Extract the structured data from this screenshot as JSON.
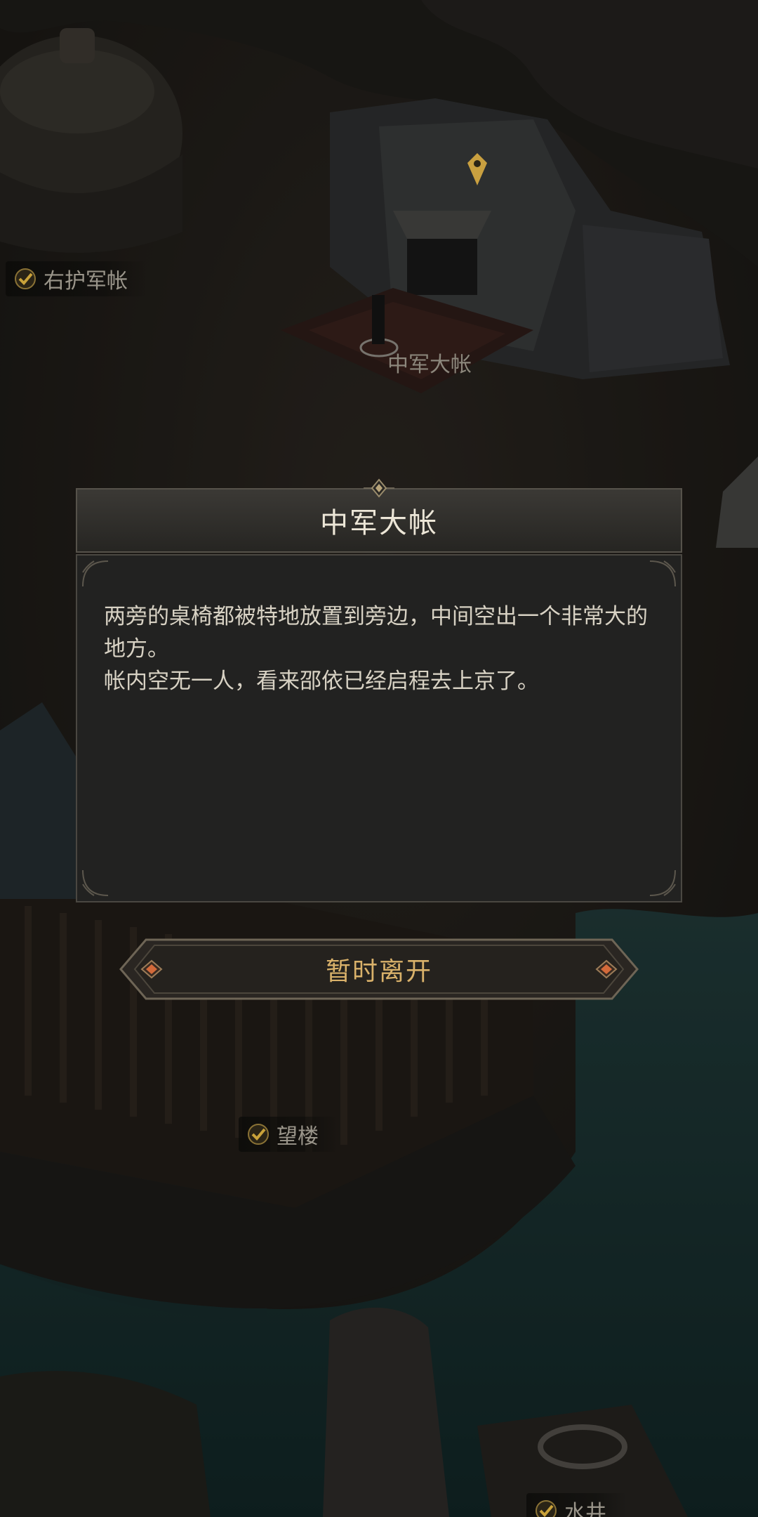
{
  "map": {
    "locations": {
      "right_guard_tent": "右护军帐",
      "central_tent": "中军大帐",
      "watchtower": "望楼",
      "well": "水井"
    }
  },
  "dialog": {
    "title": "中军大帐",
    "paragraphs": [
      "两旁的桌椅都被特地放置到旁边，中间空出一个非常大的地方。",
      "帐内空无一人，看来邵依已经启程去上京了。"
    ]
  },
  "actions": {
    "leave_label": "暂时离开"
  },
  "colors": {
    "accent_gold": "#d9b16a",
    "marker_gold": "#c9a040",
    "check_gold": "#c9a23a",
    "dialog_bg": "#222221",
    "water": "#1f3a3a"
  },
  "icons": {
    "location_check": "check-badge-icon",
    "map_marker": "location-pin-icon",
    "button_gem": "diamond-gem-icon"
  }
}
